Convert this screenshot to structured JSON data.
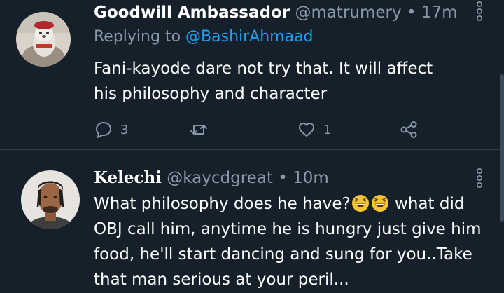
{
  "tweets": [
    {
      "display_name": "Goodwill Ambassador",
      "handle": "@matrumery",
      "separator": "•",
      "time": "17m",
      "replying_prefix": "Replying to",
      "replying_handle": "@BashirAhmaad",
      "lines": [
        "Fani-kayode dare not try that. It will affect",
        "his philosophy and character"
      ],
      "reply_count": "3",
      "retweet_count": "",
      "like_count": "1"
    },
    {
      "display_name": "Kelechi",
      "handle": "@kaycdgreat",
      "separator": "•",
      "time": "10m",
      "lines": [
        "What philosophy does he have?",
        " what did",
        "OBJ call him, anytime he is hungry just give him",
        "food, he'll start dancing and sung for you..Take",
        "that man serious at your peril..."
      ]
    }
  ],
  "icons": {
    "reply": "comment-icon",
    "retweet": "retweet-icon",
    "like": "heart-icon",
    "share": "share-icon",
    "more": "more-vertical-icon",
    "emoji": "grinning-squinting-face-emoji"
  },
  "colors": {
    "background": "#15202b",
    "text": "#ffffff",
    "muted": "#8899a6",
    "link": "#1da1f2"
  }
}
